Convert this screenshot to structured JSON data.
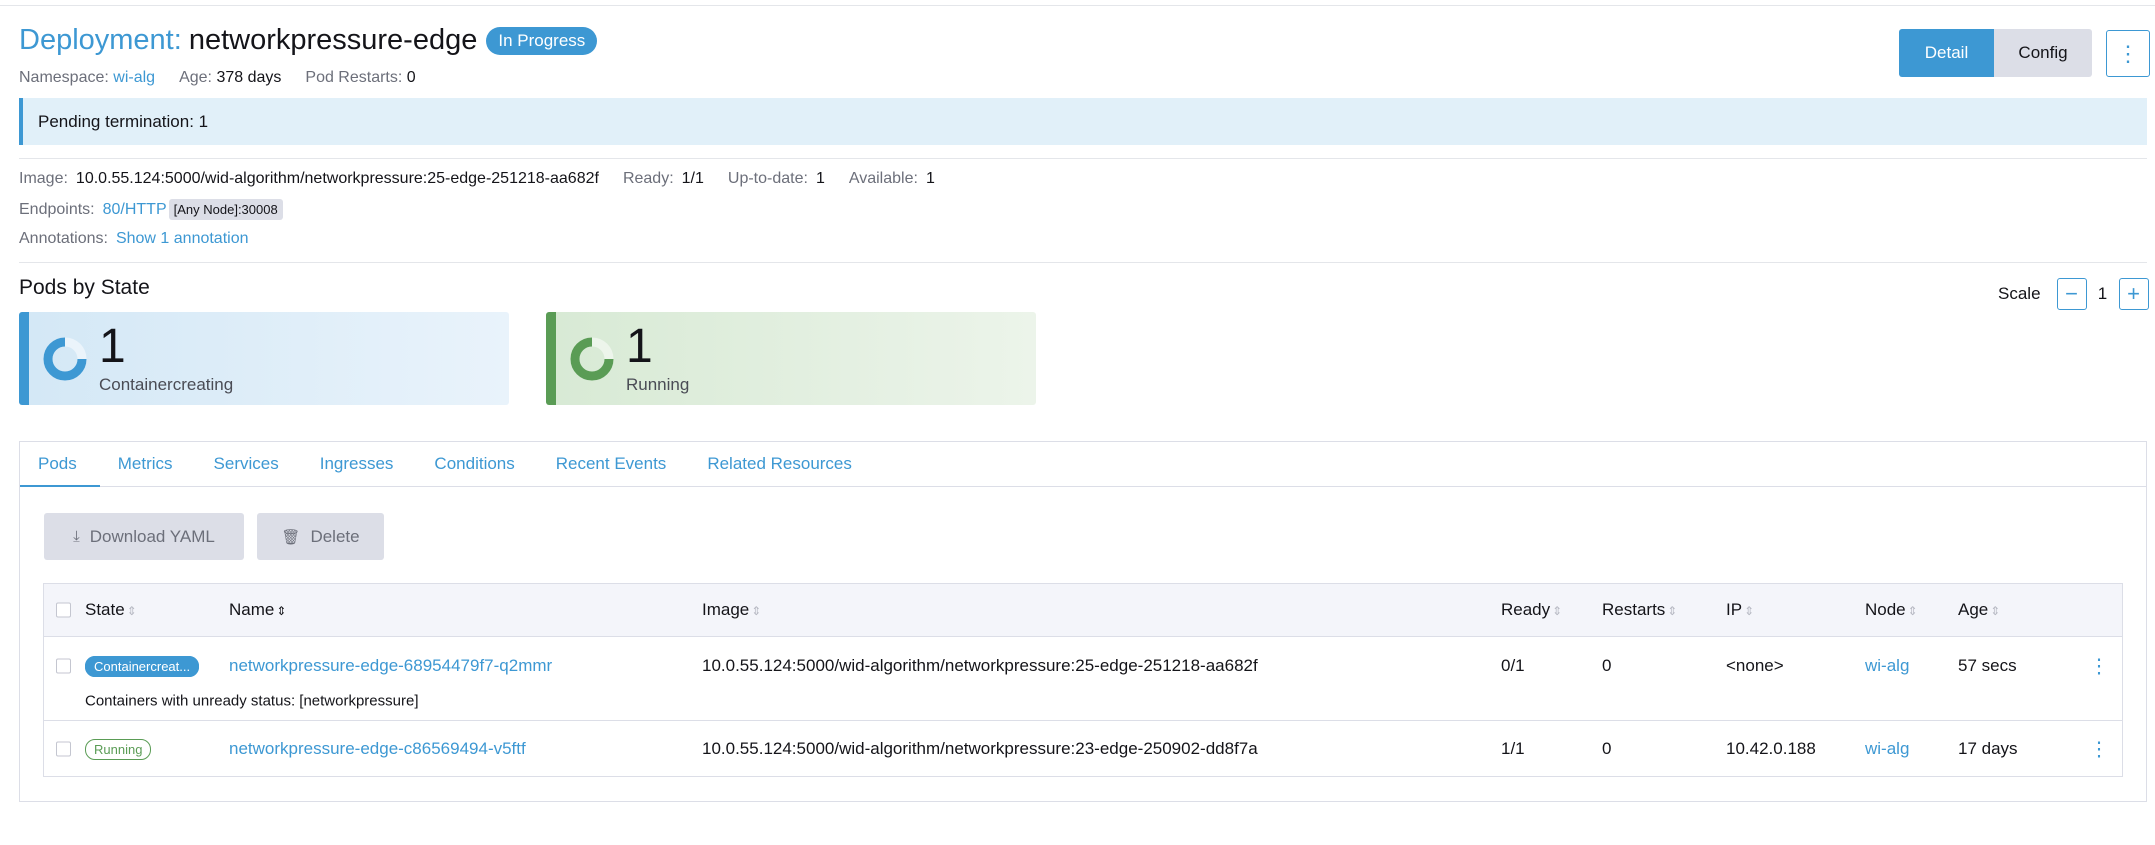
{
  "header": {
    "title_prefix": "Deployment:",
    "title_name": "networkpressure-edge",
    "status_badge": "In Progress",
    "namespace_label": "Namespace:",
    "namespace_value": "wi-alg",
    "age_label": "Age:",
    "age_value": "378 days",
    "restarts_label": "Pod Restarts:",
    "restarts_value": "0"
  },
  "view_toggle": {
    "detail": "Detail",
    "config": "Config",
    "menu_icon": "⋮"
  },
  "banner": {
    "text": "Pending termination: 1"
  },
  "info": {
    "image_label": "Image:",
    "image_value": "10.0.55.124:5000/wid-algorithm/networkpressure:25-edge-251218-aa682f",
    "ready_label": "Ready:",
    "ready_value": "1/1",
    "uptodate_label": "Up-to-date:",
    "uptodate_value": "1",
    "available_label": "Available:",
    "available_value": "1",
    "endpoints_label": "Endpoints:",
    "endpoints_link": "80/HTTP",
    "endpoints_node": "[Any Node]:30008",
    "annotations_label": "Annotations:",
    "annotations_link": "Show 1 annotation"
  },
  "pods_by_state": {
    "title": "Pods by State",
    "scale_label": "Scale",
    "scale_value": "1",
    "scale_minus": "−",
    "scale_plus": "+",
    "cards": [
      {
        "count": "1",
        "label": "Containercreating",
        "color": "#3d98d3"
      },
      {
        "count": "1",
        "label": "Running",
        "color": "#5a9c55"
      }
    ]
  },
  "tabs": [
    "Pods",
    "Metrics",
    "Services",
    "Ingresses",
    "Conditions",
    "Recent Events",
    "Related Resources"
  ],
  "actions": {
    "download": "Download YAML",
    "delete": "Delete"
  },
  "table": {
    "columns": [
      "State",
      "Name",
      "Image",
      "Ready",
      "Restarts",
      "IP",
      "Node",
      "Age"
    ],
    "rows": [
      {
        "state": "Containercreat...",
        "name": "networkpressure-edge-68954479f7-q2mmr",
        "image": "10.0.55.124:5000/wid-algorithm/networkpressure:25-edge-251218-aa682f",
        "ready": "0/1",
        "restarts": "0",
        "ip": "<none>",
        "node": "wi-alg",
        "age": "57 secs",
        "detail": "Containers with unready status: [networkpressure]"
      },
      {
        "state": "Running",
        "name": "networkpressure-edge-c86569494-v5ftf",
        "image": "10.0.55.124:5000/wid-algorithm/networkpressure:23-edge-250902-dd8f7a",
        "ready": "1/1",
        "restarts": "0",
        "ip": "10.42.0.188",
        "node": "wi-alg",
        "age": "17 days"
      }
    ]
  }
}
